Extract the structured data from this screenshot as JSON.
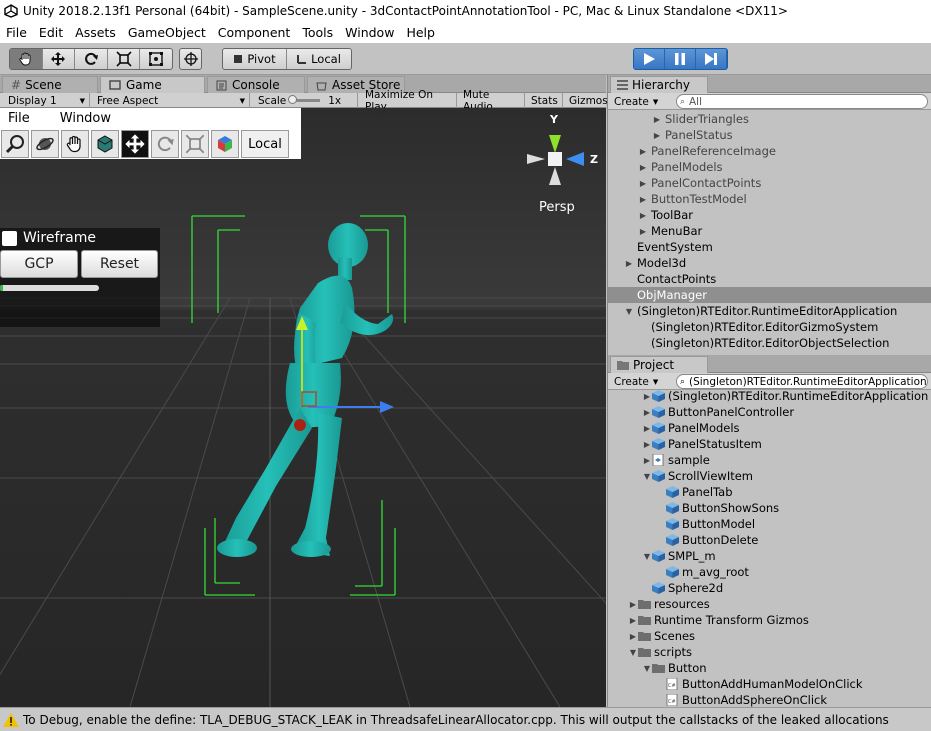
{
  "window": {
    "title": "Unity 2018.2.13f1 Personal (64bit) - SampleScene.unity - 3dContactPointAnnotationTool - PC, Mac & Linux Standalone <DX11>"
  },
  "menubar": [
    "File",
    "Edit",
    "Assets",
    "GameObject",
    "Component",
    "Tools",
    "Window",
    "Help"
  ],
  "toolbar": {
    "pivot": "Pivot",
    "local": "Local"
  },
  "tabs": {
    "scene": "Scene",
    "game": "Game",
    "console": "Console",
    "asset_store": "Asset Store"
  },
  "gamebar": {
    "display": "Display 1",
    "aspect": "Free Aspect",
    "scale_label": "Scale",
    "scale_value": "1x",
    "maximize": "Maximize On Play",
    "mute": "Mute Audio",
    "stats": "Stats",
    "gizmos": "Gizmos"
  },
  "app": {
    "menu": [
      "File",
      "Window"
    ],
    "local_button": "Local",
    "wireframe_label": "Wireframe",
    "wireframe_checked": false,
    "gcp_button": "GCP",
    "reset_button": "Reset",
    "progress": 0.03,
    "persp_label": "Persp",
    "axis_y": "Y",
    "axis_z": "Z"
  },
  "hierarchy": {
    "tab": "Hierarchy",
    "create": "Create",
    "search_placeholder": "All",
    "items": [
      {
        "label": "SliderTriangles",
        "level": 3,
        "arrow": "right",
        "gray": true
      },
      {
        "label": "PanelStatus",
        "level": 3,
        "arrow": "right",
        "gray": true
      },
      {
        "label": "PanelReferenceImage",
        "level": 2,
        "arrow": "right",
        "gray": true
      },
      {
        "label": "PanelModels",
        "level": 2,
        "arrow": "right",
        "gray": true
      },
      {
        "label": "PanelContactPoints",
        "level": 2,
        "arrow": "right",
        "gray": true
      },
      {
        "label": "ButtonTestModel",
        "level": 2,
        "arrow": "right",
        "gray": true
      },
      {
        "label": "ToolBar",
        "level": 2,
        "arrow": "right",
        "gray": false
      },
      {
        "label": "MenuBar",
        "level": 2,
        "arrow": "right",
        "gray": false
      },
      {
        "label": "EventSystem",
        "level": 1,
        "arrow": "",
        "gray": false
      },
      {
        "label": "Model3d",
        "level": 1,
        "arrow": "right",
        "gray": false
      },
      {
        "label": "ContactPoints",
        "level": 1,
        "arrow": "",
        "gray": false
      },
      {
        "label": "ObjManager",
        "level": 1,
        "arrow": "",
        "gray": false,
        "selected": true
      },
      {
        "label": "(Singleton)RTEditor.RuntimeEditorApplication",
        "level": 1,
        "arrow": "down",
        "gray": false
      },
      {
        "label": "(Singleton)RTEditor.EditorGizmoSystem",
        "level": 2,
        "arrow": "",
        "gray": false
      },
      {
        "label": "(Singleton)RTEditor.EditorObjectSelection",
        "level": 2,
        "arrow": "",
        "gray": false
      }
    ]
  },
  "project": {
    "tab": "Project",
    "create": "Create",
    "search_value": "(Singleton)RTEditor.RuntimeEditorApplication",
    "items": [
      {
        "label": "(Singleton)RTEditor.RuntimeEditorApplication",
        "level": 2,
        "arrow": "right",
        "icon": "cube"
      },
      {
        "label": "ButtonPanelController",
        "level": 2,
        "arrow": "right",
        "icon": "cube"
      },
      {
        "label": "PanelModels",
        "level": 2,
        "arrow": "right",
        "icon": "cube"
      },
      {
        "label": "PanelStatusItem",
        "level": 2,
        "arrow": "right",
        "icon": "cube"
      },
      {
        "label": "sample",
        "level": 2,
        "arrow": "right",
        "icon": "scene"
      },
      {
        "label": "ScrollViewItem",
        "level": 2,
        "arrow": "down",
        "icon": "cube"
      },
      {
        "label": "PanelTab",
        "level": 3,
        "arrow": "",
        "icon": "cube"
      },
      {
        "label": "ButtonShowSons",
        "level": 3,
        "arrow": "",
        "icon": "cube"
      },
      {
        "label": "ButtonModel",
        "level": 3,
        "arrow": "",
        "icon": "cube"
      },
      {
        "label": "ButtonDelete",
        "level": 3,
        "arrow": "",
        "icon": "cube"
      },
      {
        "label": "SMPL_m",
        "level": 2,
        "arrow": "down",
        "icon": "cube"
      },
      {
        "label": "m_avg_root",
        "level": 3,
        "arrow": "",
        "icon": "cube"
      },
      {
        "label": "Sphere2d",
        "level": 2,
        "arrow": "",
        "icon": "cube"
      },
      {
        "label": "resources",
        "level": 1,
        "arrow": "right",
        "icon": "folder"
      },
      {
        "label": "Runtime Transform Gizmos",
        "level": 1,
        "arrow": "right",
        "icon": "folder"
      },
      {
        "label": "Scenes",
        "level": 1,
        "arrow": "right",
        "icon": "folder"
      },
      {
        "label": "scripts",
        "level": 1,
        "arrow": "down",
        "icon": "folder"
      },
      {
        "label": "Button",
        "level": 2,
        "arrow": "down",
        "icon": "folder"
      },
      {
        "label": "ButtonAddHumanModelOnClick",
        "level": 3,
        "arrow": "",
        "icon": "script"
      },
      {
        "label": "ButtonAddSphereOnClick",
        "level": 3,
        "arrow": "",
        "icon": "script"
      }
    ]
  },
  "status": {
    "message": "To Debug, enable the define: TLA_DEBUG_STACK_LEAK in ThreadsafeLinearAllocator.cpp. This will output the callstacks of the leaked allocations"
  },
  "colors": {
    "model": "#20b7b0",
    "gizmo_green": "#33dd33",
    "play_blue": "#3a78c6",
    "scene_bg": "#303030"
  }
}
